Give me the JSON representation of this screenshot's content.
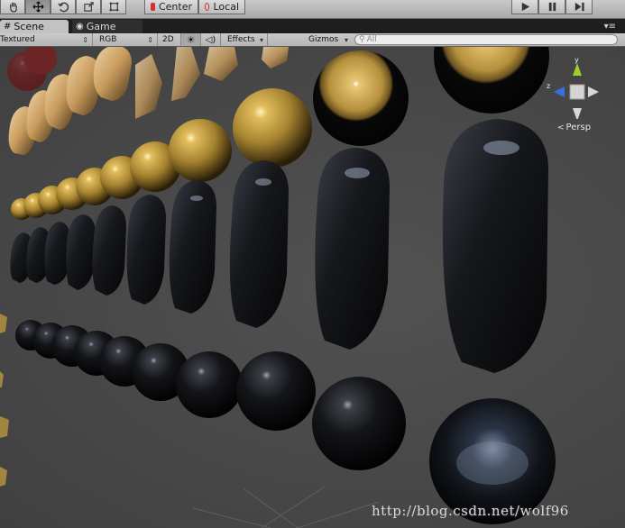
{
  "toolbar": {
    "tools": [
      {
        "name": "hand-tool-button",
        "icon": "hand-icon"
      },
      {
        "name": "move-tool-button",
        "icon": "move-icon",
        "active": true
      },
      {
        "name": "rotate-tool-button",
        "icon": "rotate-icon"
      },
      {
        "name": "scale-tool-button",
        "icon": "scale-icon"
      },
      {
        "name": "rect-tool-button",
        "icon": "rect-icon"
      }
    ],
    "pivot_mode": "Center",
    "pivot_rotation": "Local",
    "play_controls": [
      "play-icon",
      "pause-icon",
      "step-icon"
    ]
  },
  "tabs": [
    {
      "label": "Scene",
      "icon": "scene-icon",
      "active": true
    },
    {
      "label": "Game",
      "icon": "game-icon",
      "active": false
    }
  ],
  "scene_controls": {
    "draw_mode": "Textured",
    "render_mode": "RGB",
    "mode_2d": "2D",
    "lighting_icon": "sun-icon",
    "audio_icon": "speaker-icon",
    "effects": "Effects",
    "gizmos": "Gizmos",
    "search_placeholder": "All",
    "search_icon": "search-icon"
  },
  "viewport": {
    "projection": "Persp",
    "axis_labels": {
      "y": "y",
      "z": "z"
    },
    "axis_colors": {
      "x": "#d9332b",
      "y": "#9ccf2f",
      "z": "#3a6ee0"
    },
    "watermark": "http://blog.csdn.net/wolf96"
  },
  "colors": {
    "toolbar_bg": "#bdbdbd",
    "viewport_bg": "#464646",
    "gold": "#b89540",
    "dark_glossy": "#0b0b0d"
  }
}
